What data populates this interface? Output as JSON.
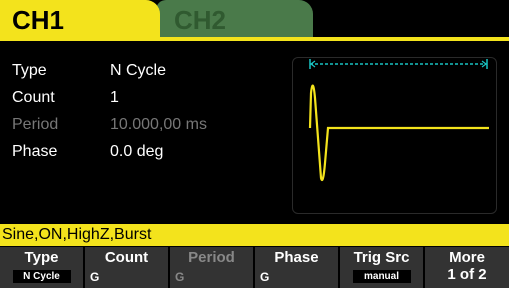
{
  "tabs": {
    "ch1": "CH1",
    "ch2": "CH2"
  },
  "params": {
    "type": {
      "label": "Type",
      "value": "N Cycle"
    },
    "count": {
      "label": "Count",
      "value": "1"
    },
    "period": {
      "label": "Period",
      "value": "10.000,00 ms"
    },
    "phase": {
      "label": "Phase",
      "value": "0.0 deg"
    }
  },
  "status": "Sine,ON,HighZ,Burst",
  "softkeys": {
    "type": {
      "title": "Type",
      "sub": "N Cycle"
    },
    "count": {
      "title": "Count"
    },
    "period": {
      "title": "Period"
    },
    "phase": {
      "title": "Phase"
    },
    "trig_src": {
      "title": "Trig Src",
      "sub": "manual"
    },
    "more": {
      "title": "More",
      "sub": "1 of 2"
    }
  },
  "icons": {
    "knob": "rotary-knob-icon"
  },
  "colors": {
    "accent": "#f3e31c",
    "ch2_tab": "#4a7a4a",
    "marker": "#19c3c3",
    "softkey_bg": "#333333"
  }
}
